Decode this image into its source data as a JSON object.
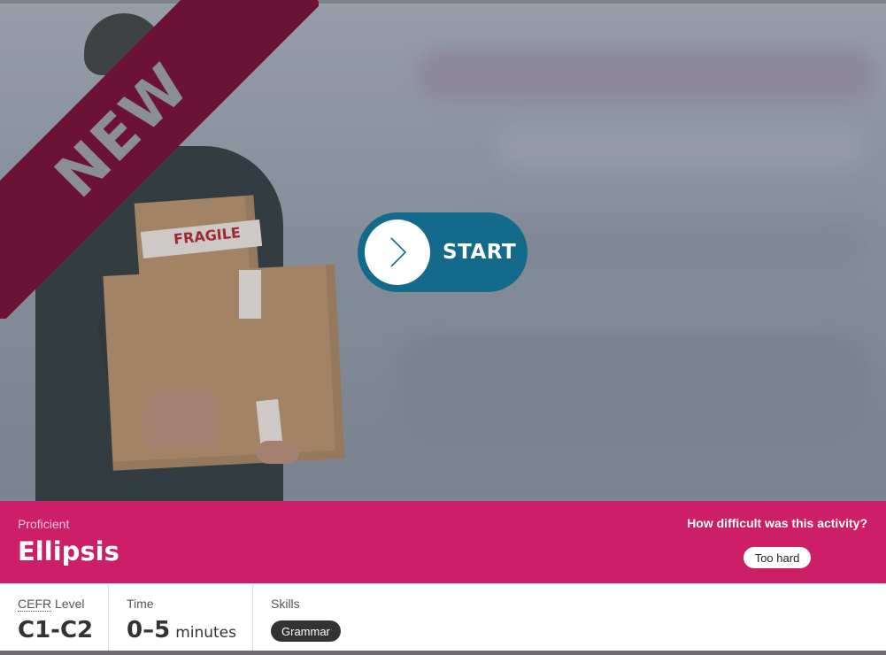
{
  "hero": {
    "badge": "NEW",
    "image_description_icon": "delivery-man-with-boxes-image",
    "tape_text": "FRAGILE",
    "start_label": "START"
  },
  "title_bar": {
    "level_name": "Proficient",
    "title": "Ellipsis",
    "difficulty_question": "How difficult was this activity?",
    "rating_option": "Too hard",
    "color": "#cc1f67"
  },
  "info": {
    "cefr_abbr": "CEFR",
    "cefr_label_suffix": " Level",
    "cefr_value": "C1-C2",
    "time_label": "Time",
    "time_value": "0–5",
    "time_unit": "minutes",
    "skills_label": "Skills",
    "skills": [
      "Grammar"
    ]
  },
  "colors": {
    "ribbon": "#6d1237",
    "start_button": "#136a8a",
    "skill_tag": "#333333"
  }
}
